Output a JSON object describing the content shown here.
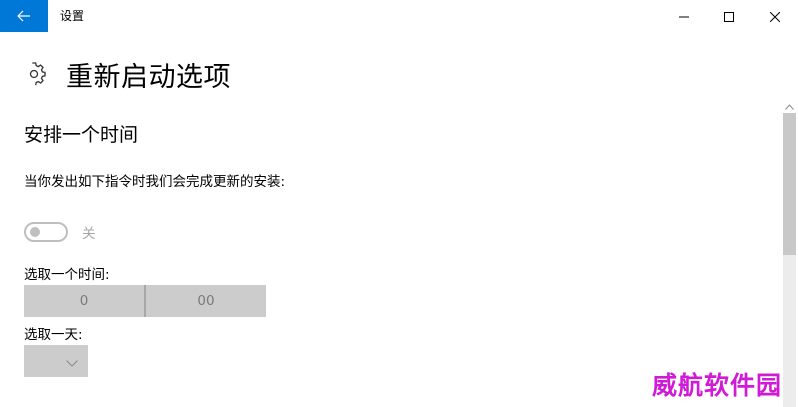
{
  "window": {
    "title": "设置"
  },
  "page": {
    "title": "重新启动选项"
  },
  "schedule": {
    "heading": "安排一个时间",
    "description": "当你发出如下指令时我们会完成更新的安装:",
    "toggle_state_label": "关",
    "toggle_on": false,
    "time_label": "选取一个时间:",
    "hour": "0",
    "minute": "00",
    "day_label": "选取一天:",
    "day_value": ""
  },
  "icons": {
    "back": "back-arrow-icon",
    "settings": "gear-icon",
    "minimize": "minimize-icon",
    "maximize": "maximize-icon",
    "close": "close-icon",
    "dropdown": "chevron-down-icon",
    "scroll_up": "chevron-up-icon"
  },
  "colors": {
    "accent": "#0078d7",
    "disabled_control": "#cccccc",
    "watermark": "#d11ad6"
  },
  "watermark": {
    "text": "威航软件园"
  }
}
